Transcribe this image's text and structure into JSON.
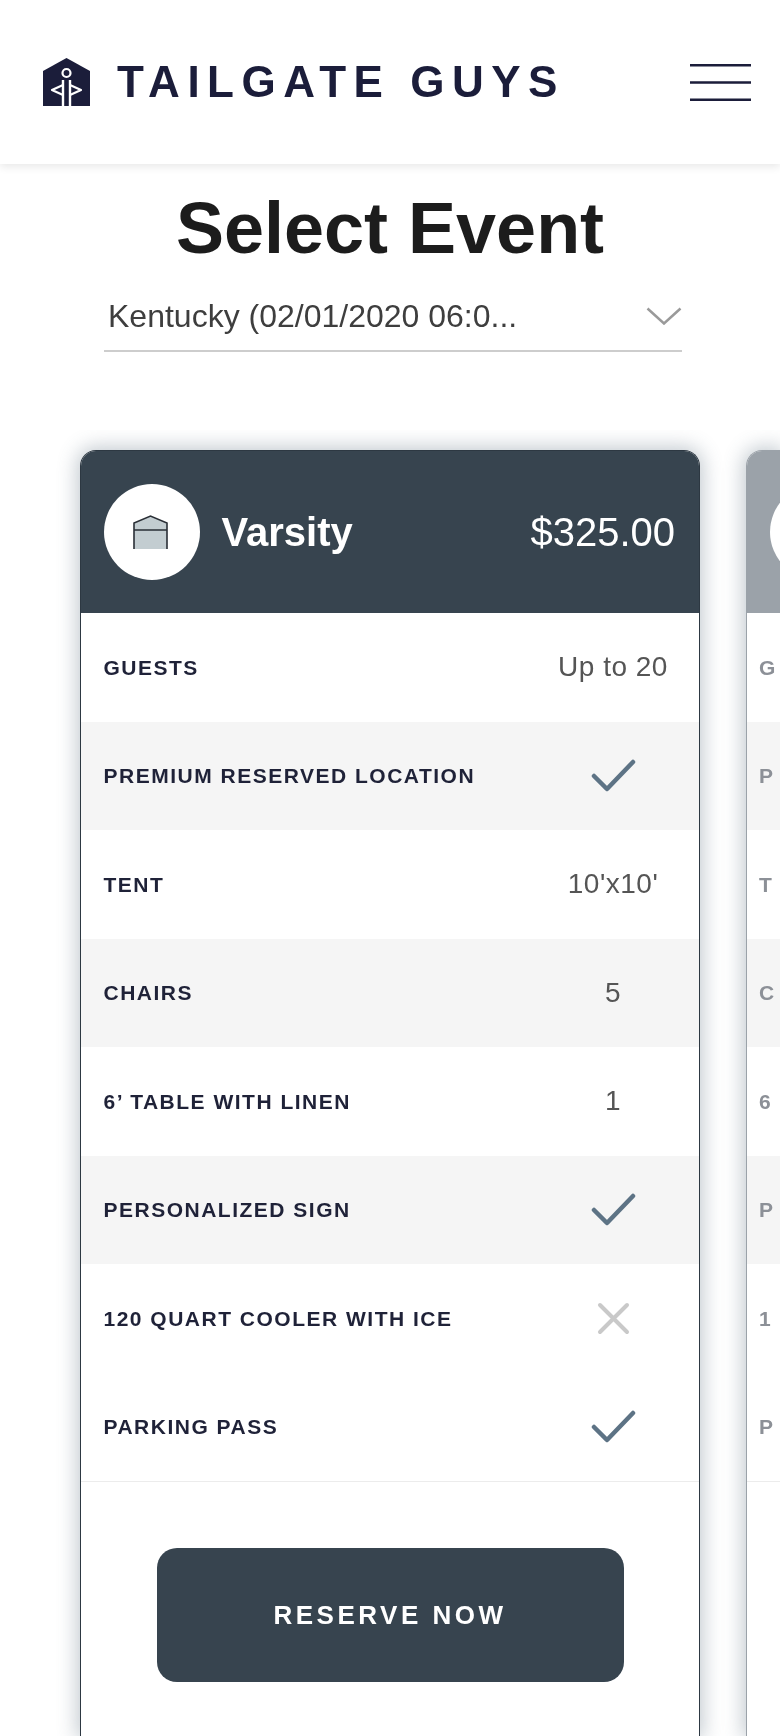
{
  "header": {
    "brand": "TAILGATE GUYS"
  },
  "title": "Select Event",
  "event_select": {
    "value": "Kentucky (02/01/2020 06:0..."
  },
  "packages": [
    {
      "selected": true,
      "name": "Varsity",
      "price": "$325.00",
      "features": [
        {
          "label": "GUESTS",
          "kind": "text",
          "value": "Up to 20"
        },
        {
          "label": "PREMIUM RESERVED LOCATION",
          "kind": "mark",
          "included": true
        },
        {
          "label": "TENT",
          "kind": "text",
          "value": "10'x10'"
        },
        {
          "label": "CHAIRS",
          "kind": "text",
          "value": "5"
        },
        {
          "label": "6’ TABLE WITH LINEN",
          "kind": "text",
          "value": "1"
        },
        {
          "label": "PERSONALIZED SIGN",
          "kind": "mark",
          "included": true
        },
        {
          "label": "120 QUART COOLER WITH ICE",
          "kind": "mark",
          "included": false
        },
        {
          "label": "PARKING PASS",
          "kind": "mark",
          "included": true
        }
      ],
      "button": "RESERVE NOW"
    },
    {
      "selected": false,
      "features": [
        {
          "label": "G"
        },
        {
          "label": "P"
        },
        {
          "label": "T"
        },
        {
          "label": "C"
        },
        {
          "label": "6"
        },
        {
          "label": "P"
        },
        {
          "label": "1"
        },
        {
          "label": "P"
        }
      ]
    }
  ]
}
